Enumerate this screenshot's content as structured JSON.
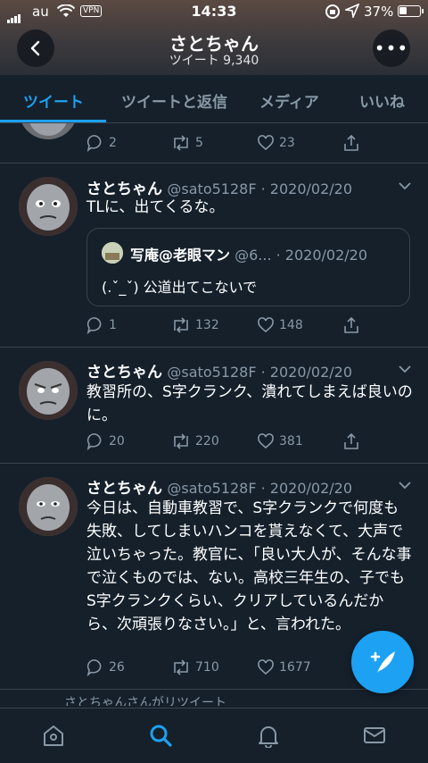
{
  "status_bar": {
    "carrier": "au",
    "vpn": "VPN",
    "time": "14:33",
    "battery": "37%"
  },
  "header": {
    "title": "さとちゃん",
    "subtitle": "ツイート 9,340"
  },
  "tabs": [
    {
      "label": "ツイート",
      "active": true
    },
    {
      "label": "ツイートと返信",
      "active": false
    },
    {
      "label": "メディア",
      "active": false
    },
    {
      "label": "いいね",
      "active": false
    }
  ],
  "tweets": [
    {
      "replies": "2",
      "retweets": "5",
      "likes": "23"
    },
    {
      "name": "さとちゃん",
      "meta": "@sato5128F · 2020/02/20",
      "text": "TLに、出てくるな。",
      "quote": {
        "name": "写庵@老眼マン",
        "meta": "@6... · 2020/02/20",
        "text": "(.ˇ_ˇ) 公道出てこないで"
      },
      "replies": "1",
      "retweets": "132",
      "likes": "148"
    },
    {
      "name": "さとちゃん",
      "meta": "@sato5128F · 2020/02/20",
      "text": "教習所の、S字クランク、潰れてしまえば良いのに。",
      "replies": "20",
      "retweets": "220",
      "likes": "381"
    },
    {
      "name": "さとちゃん",
      "meta": "@sato5128F · 2020/02/20",
      "text": "今日は、自動車教習で、S字クランクで何度も失敗、してしまいハンコを貰えなくて、大声で泣いちゃった。教官に、「良い大人が、そんな事で泣くものでは、ない。高校三年生の、子でもS字クランクくらい、クリアしているんだから、次頑張りなさい。」と、言われた。",
      "replies": "26",
      "retweets": "710",
      "likes": "1677"
    }
  ],
  "next_item_note": "さとちゃんさんがリツイート",
  "colors": {
    "background": "#15202b",
    "accent": "#1da1f2",
    "muted": "#8899a6",
    "divider": "#38444d"
  },
  "icons": [
    "back-arrow-icon",
    "more-icon",
    "reply-icon",
    "retweet-icon",
    "like-icon",
    "share-icon",
    "compose-icon",
    "home-icon",
    "search-icon",
    "notifications-icon",
    "messages-icon"
  ]
}
